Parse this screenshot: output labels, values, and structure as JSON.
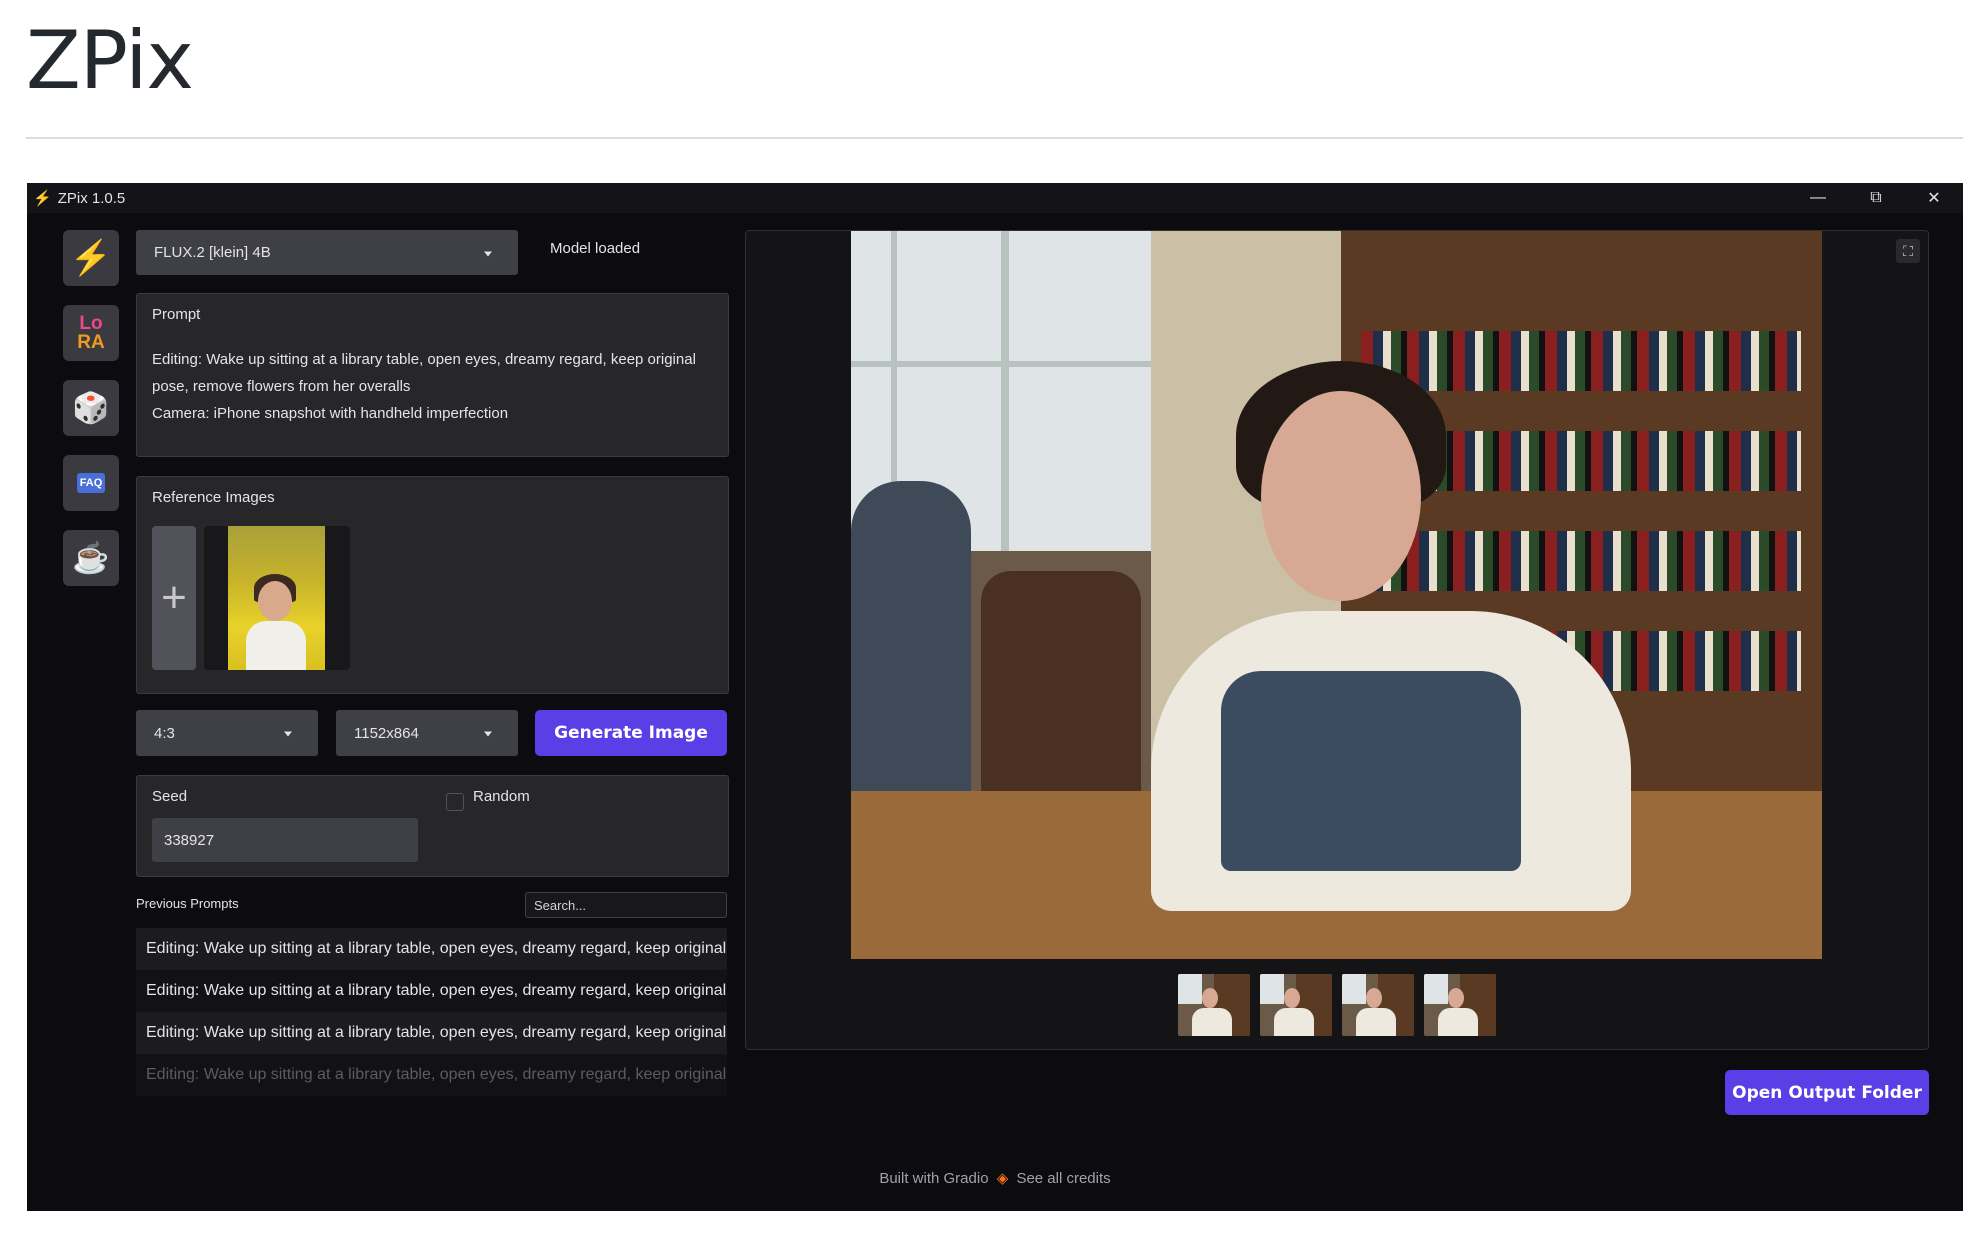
{
  "page": {
    "heading": "ZPix"
  },
  "window": {
    "title": "ZPix 1.0.5",
    "icon": "lightning-icon",
    "controls": {
      "minimize": "—",
      "restore": "⧉",
      "close": "✕"
    }
  },
  "rail": {
    "items": [
      {
        "name": "lightning-icon",
        "glyph": "⚡"
      },
      {
        "name": "lora-icon",
        "line1": "Lo",
        "line2": "RA"
      },
      {
        "name": "dice-icon",
        "glyph": "🎲"
      },
      {
        "name": "faq-icon",
        "glyph": "FAQ"
      },
      {
        "name": "kofi-cup-icon",
        "glyph": "☕"
      }
    ]
  },
  "model": {
    "selected": "FLUX.2 [klein] 4B",
    "status": "Model loaded"
  },
  "prompt": {
    "label": "Prompt",
    "value": "Editing: Wake up sitting at a library table, open eyes, dreamy regard, keep original pose, remove flowers from her overalls\nCamera: iPhone snapshot with handheld imperfection"
  },
  "reference": {
    "label": "Reference Images",
    "add_glyph": "+"
  },
  "aspect": {
    "selected": "4:3"
  },
  "resolution": {
    "selected": "1152x864"
  },
  "generate": {
    "label": "Generate Image"
  },
  "seed": {
    "label": "Seed",
    "value": "338927",
    "random_label": "Random",
    "random_checked": false
  },
  "history": {
    "label": "Previous Prompts",
    "search_placeholder": "Search...",
    "items": [
      "Editing: Wake up sitting at a library table, open eyes, dreamy regard, keep original",
      "Editing: Wake up sitting at a library table, open eyes, dreamy regard, keep original",
      "Editing: Wake up sitting at a library table, open eyes, dreamy regard, keep original",
      "Editing: Wake up sitting at a library table, open eyes, dreamy regard, keep original"
    ]
  },
  "viewer": {
    "fullscreen_glyph": "⛶",
    "thumbnail_count": 4
  },
  "output": {
    "open_folder_label": "Open Output Folder"
  },
  "footer": {
    "built_with": "Built with Gradio",
    "credits": "See all credits"
  },
  "colors": {
    "accent": "#5b3fe6",
    "background": "#0c0c10",
    "panel": "#27272a"
  }
}
